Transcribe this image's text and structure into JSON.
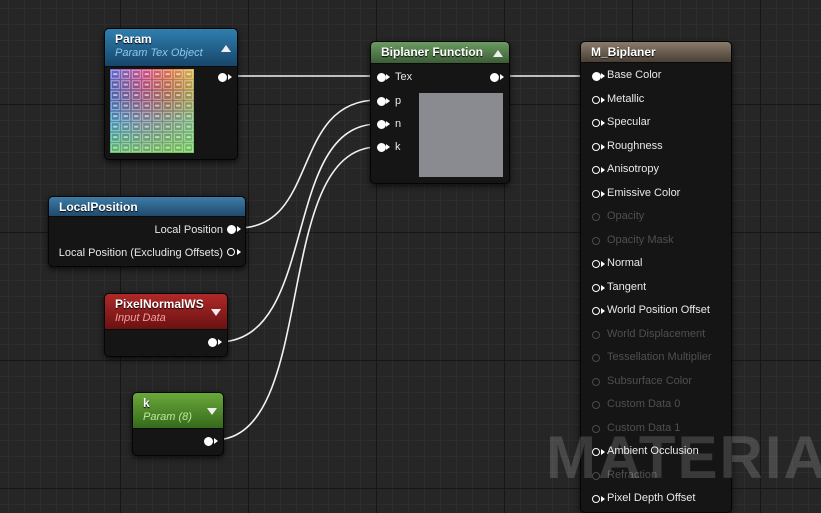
{
  "nodes": {
    "param": {
      "title": "Param",
      "subtitle": "Param Tex Object"
    },
    "local_position": {
      "title": "LocalPosition",
      "outputs": [
        "Local Position",
        "Local Position (Excluding Offsets)"
      ]
    },
    "pixel_normal": {
      "title": "PixelNormalWS",
      "subtitle": "Input Data"
    },
    "k_param": {
      "title": "k",
      "subtitle": "Param (8)"
    },
    "biplaner": {
      "title": "Biplaner Function",
      "inputs": [
        "Tex",
        "p",
        "n",
        "k"
      ]
    },
    "material": {
      "title": "M_Biplaner",
      "pins": [
        {
          "label": "Base Color",
          "state": "connected"
        },
        {
          "label": "Metallic",
          "state": "active"
        },
        {
          "label": "Specular",
          "state": "active"
        },
        {
          "label": "Roughness",
          "state": "active"
        },
        {
          "label": "Anisotropy",
          "state": "active"
        },
        {
          "label": "Emissive Color",
          "state": "active"
        },
        {
          "label": "Opacity",
          "state": "disabled"
        },
        {
          "label": "Opacity Mask",
          "state": "disabled"
        },
        {
          "label": "Normal",
          "state": "active"
        },
        {
          "label": "Tangent",
          "state": "active"
        },
        {
          "label": "World Position Offset",
          "state": "active"
        },
        {
          "label": "World Displacement",
          "state": "disabled"
        },
        {
          "label": "Tessellation Multiplier",
          "state": "disabled"
        },
        {
          "label": "Subsurface Color",
          "state": "disabled"
        },
        {
          "label": "Custom Data 0",
          "state": "disabled"
        },
        {
          "label": "Custom Data 1",
          "state": "disabled"
        },
        {
          "label": "Ambient Occlusion",
          "state": "active"
        },
        {
          "label": "Refraction",
          "state": "disabled"
        },
        {
          "label": "Pixel Depth Offset",
          "state": "active"
        }
      ]
    }
  },
  "watermark": "MATERIAL",
  "colors": {
    "param_header": "#1e5a85",
    "local_position_header": "#2a5f84",
    "pixel_normal_header": "#8a1c1c",
    "k_header": "#4d8a2a",
    "biplaner_header": "#4f7a4a",
    "material_header": "#7a6a5a",
    "preview_gray": "#8a8a91"
  },
  "icons": {
    "collapse_up": "triangle-up-icon",
    "collapse_down": "triangle-down-icon",
    "texture_preview": "uv-grid-texture-icon"
  }
}
